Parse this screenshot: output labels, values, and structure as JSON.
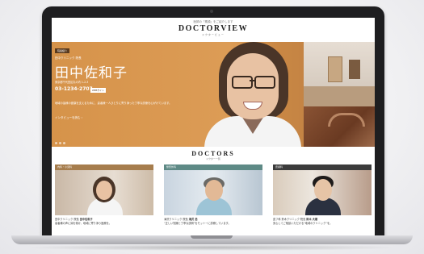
{
  "site": {
    "tagline": "医師の「素顔」をご紹介します",
    "logo": "DOCTORVIEW",
    "logo_kana": "ドクタービュー"
  },
  "hero": {
    "badge": "院長紹介",
    "sub": "田中クリニック 院長",
    "name": "田中佐和子",
    "address": "東京都千代田区丸の内 1-2-3",
    "phone": "03-1234-2707",
    "web_button": "WEBサイト",
    "description": "地域の皆様の健康を支えるために、患者様一人ひとりに寄り添った丁寧な診療を心がけています。",
    "more_link": "インタビューを読む ›"
  },
  "doctors": {
    "title": "DOCTORS",
    "title_kana": "ドクター一覧",
    "cards": [
      {
        "label": "内科・小児科",
        "clinic": "田中クリニック 院長",
        "name": "田中佐和子",
        "desc": "患者様の声に耳を傾け、地域に寄り添う医療を。"
      },
      {
        "label": "整形外科",
        "clinic": "滝沢クリニック 院長",
        "name": "滝沢 浩",
        "desc": "“正しい知識と丁寧な説明”をモットーに診療しています。"
      },
      {
        "label": "皮膚科",
        "clinic": "皮フ科 鈴木クリニック 院長",
        "name": "鈴木 大樹",
        "desc": "安心してご相談いただける“地域のクリニック”を。"
      }
    ]
  },
  "colors": {
    "hero": "#d89a4f",
    "bar_dark": "#3b3b3b",
    "bar_tan": "#a67d4d",
    "bar_teal": "#5e8a86"
  }
}
